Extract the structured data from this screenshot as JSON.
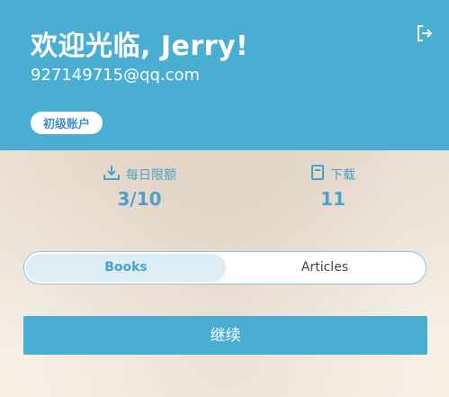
{
  "header": {
    "title": "欢迎光临, Jerry!",
    "email": "927149715@qq.com",
    "badge": "初级账户",
    "logout_icon": "logout-icon"
  },
  "stats": {
    "daily_limit_label": "每日限额",
    "daily_limit_value": "3/10",
    "download_label": "下载",
    "download_value": "11"
  },
  "tabs": {
    "books": "Books",
    "articles": "Articles",
    "selected": "Books"
  },
  "actions": {
    "continue_label": "继续"
  },
  "colors": {
    "accent": "#4aadd2",
    "stat_text": "#4aa1cc",
    "toggle_selected_bg": "#dcedf5"
  }
}
